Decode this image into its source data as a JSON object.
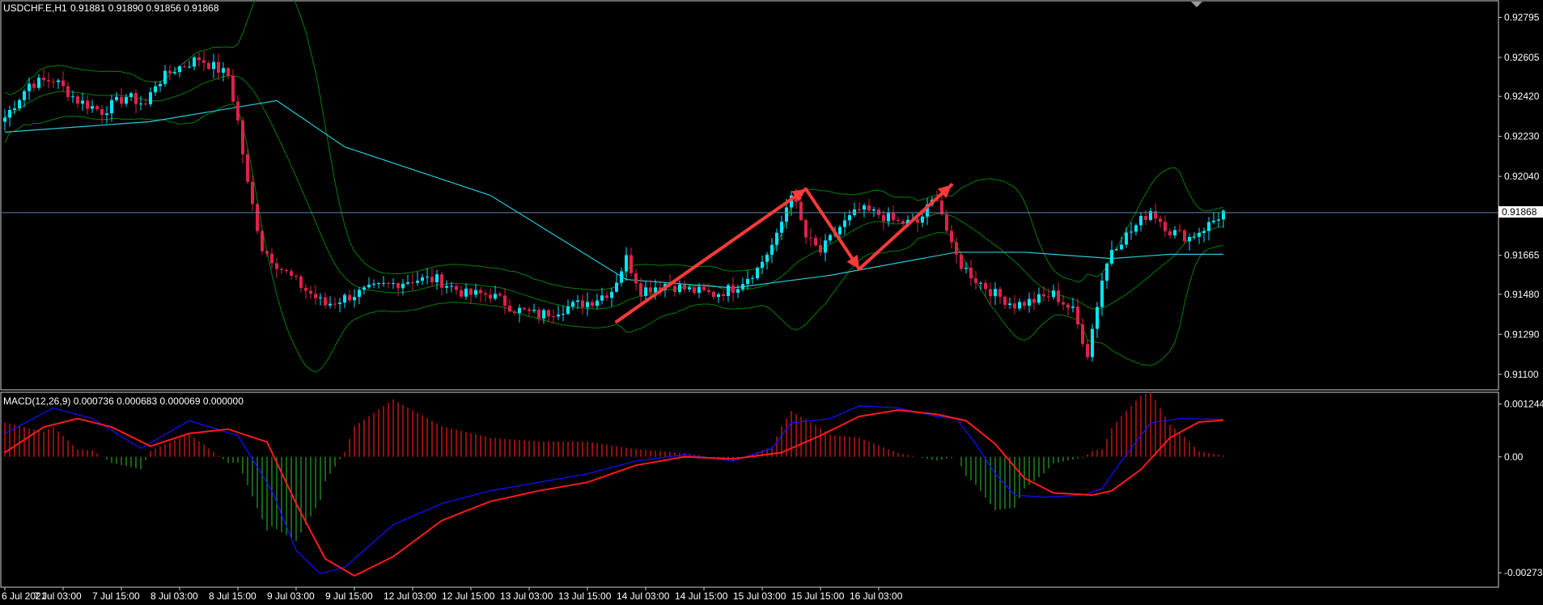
{
  "header": {
    "symbol_label": "USDCHF.E,H1",
    "ohlc_text": "0.91881 0.91890 0.91856 0.91868"
  },
  "macd_header": {
    "label": "MACD(12,26,9) 0.000736 0.000683 0.000069 0.000000"
  },
  "colors": {
    "background": "#000000",
    "frame": "#cfcfcf",
    "bull_candle": "#00e5ff",
    "bear_candle": "#e0204a",
    "bollinger": "#008000",
    "moving_average": "#28c8d8",
    "current_price_line": "#5a8aa8",
    "arrows": "#ff3b3b",
    "macd_line": "#1010ff",
    "signal_line": "#ff1a1a",
    "hist_positive": "#d01515",
    "hist_negative": "#1f8f1f"
  },
  "chart_data": [
    {
      "type": "candlestick",
      "title": "USDCHF.E,H1",
      "ylim": [
        0.9103,
        0.9287
      ],
      "y_ticks": [
        "0.92795",
        "0.92605",
        "0.92420",
        "0.92230",
        "0.92040",
        "0.91665",
        "0.91480",
        "0.91290",
        "0.91100"
      ],
      "current_price": "0.91868",
      "x_labels": [
        "6 Jul 2021",
        "7 Jul 03:00",
        "7 Jul 15:00",
        "8 Jul 03:00",
        "8 Jul 15:00",
        "9 Jul 03:00",
        "9 Jul 15:00",
        "12 Jul 03:00",
        "12 Jul 15:00",
        "13 Jul 03:00",
        "13 Jul 15:00",
        "14 Jul 03:00",
        "14 Jul 15:00",
        "15 Jul 03:00",
        "15 Jul 15:00",
        "16 Jul 03:00"
      ],
      "close_path": [
        [
          0,
          0.9232
        ],
        [
          5,
          0.9248
        ],
        [
          10,
          0.925
        ],
        [
          15,
          0.924
        ],
        [
          20,
          0.9235
        ],
        [
          25,
          0.9242
        ],
        [
          29,
          0.9238
        ],
        [
          31,
          0.9248
        ],
        [
          35,
          0.9255
        ],
        [
          40,
          0.926
        ],
        [
          46,
          0.9252
        ],
        [
          48,
          0.923
        ],
        [
          50,
          0.92
        ],
        [
          53,
          0.917
        ],
        [
          57,
          0.916
        ],
        [
          62,
          0.915
        ],
        [
          66,
          0.9143
        ],
        [
          72,
          0.9148
        ],
        [
          78,
          0.9152
        ],
        [
          84,
          0.9155
        ],
        [
          89,
          0.9155
        ],
        [
          95,
          0.9148
        ],
        [
          100,
          0.9148
        ],
        [
          105,
          0.9141
        ],
        [
          110,
          0.9138
        ],
        [
          116,
          0.9142
        ],
        [
          121,
          0.9145
        ],
        [
          125,
          0.915
        ],
        [
          128,
          0.9165
        ],
        [
          131,
          0.915
        ],
        [
          136,
          0.9153
        ],
        [
          141,
          0.915
        ],
        [
          146,
          0.9148
        ],
        [
          150,
          0.9151
        ],
        [
          155,
          0.916
        ],
        [
          159,
          0.9175
        ],
        [
          162,
          0.9197
        ],
        [
          165,
          0.9175
        ],
        [
          168,
          0.9168
        ],
        [
          172,
          0.918
        ],
        [
          176,
          0.9188
        ],
        [
          180,
          0.9186
        ],
        [
          184,
          0.9182
        ],
        [
          188,
          0.9182
        ],
        [
          192,
          0.9195
        ],
        [
          195,
          0.917
        ],
        [
          197,
          0.9162
        ],
        [
          200,
          0.9155
        ],
        [
          204,
          0.9148
        ],
        [
          208,
          0.9143
        ],
        [
          212,
          0.9145
        ],
        [
          216,
          0.9148
        ],
        [
          220,
          0.914
        ],
        [
          223,
          0.912
        ],
        [
          226,
          0.9155
        ],
        [
          228,
          0.917
        ],
        [
          232,
          0.9178
        ],
        [
          236,
          0.9188
        ],
        [
          240,
          0.9178
        ],
        [
          244,
          0.9175
        ],
        [
          248,
          0.9181
        ],
        [
          251,
          0.9187
        ]
      ],
      "series": [
        {
          "name": "Bollinger Bands",
          "x_end": 251
        },
        {
          "name": "Moving Average",
          "points": [
            [
              0,
              0.9225
            ],
            [
              30,
              0.923
            ],
            [
              56,
              0.924
            ],
            [
              70,
              0.9218
            ],
            [
              100,
              0.9195
            ],
            [
              128,
              0.9155
            ],
            [
              150,
              0.9151
            ],
            [
              170,
              0.9157
            ],
            [
              196,
              0.9168
            ],
            [
              210,
              0.9168
            ],
            [
              228,
              0.9165
            ],
            [
              240,
              0.9167
            ],
            [
              251,
              0.9167
            ]
          ]
        }
      ],
      "annotations": [
        {
          "type": "arrow",
          "from": [
            126,
            0.9135
          ],
          "to": [
            165,
            0.9198
          ]
        },
        {
          "type": "arrow",
          "from": [
            165,
            0.9198
          ],
          "to": [
            176,
            0.916
          ]
        },
        {
          "type": "arrow",
          "from": [
            176,
            0.916
          ],
          "to": [
            195,
            0.92
          ]
        }
      ]
    },
    {
      "type": "bar_line",
      "title": "MACD(12,26,9)",
      "ylim": [
        -0.00305,
        0.0015
      ],
      "y_ticks": [
        "0.001244",
        "0.00",
        "-0.002730"
      ],
      "series": [
        {
          "name": "MACD",
          "points": [
            [
              0,
              0.00055
            ],
            [
              10,
              0.00115
            ],
            [
              18,
              0.0009
            ],
            [
              28,
              0.0002
            ],
            [
              38,
              0.00085
            ],
            [
              48,
              0.0005
            ],
            [
              55,
              -0.0008
            ],
            [
              60,
              -0.0022
            ],
            [
              65,
              -0.00275
            ],
            [
              70,
              -0.0026
            ],
            [
              80,
              -0.0016
            ],
            [
              90,
              -0.0011
            ],
            [
              100,
              -0.0008
            ],
            [
              110,
              -0.0006
            ],
            [
              120,
              -0.0004
            ],
            [
              130,
              -0.0001
            ],
            [
              140,
              5e-05
            ],
            [
              150,
              -0.0001
            ],
            [
              158,
              0.0002
            ],
            [
              162,
              0.0008
            ],
            [
              170,
              0.0009
            ],
            [
              176,
              0.0012
            ],
            [
              184,
              0.00115
            ],
            [
              192,
              0.00095
            ],
            [
              196,
              0.0009
            ],
            [
              200,
              0.0003
            ],
            [
              204,
              -0.0004
            ],
            [
              208,
              -0.0009
            ],
            [
              214,
              -0.00095
            ],
            [
              222,
              -0.0009
            ],
            [
              226,
              -0.00075
            ],
            [
              230,
              -0.0001
            ],
            [
              236,
              0.0008
            ],
            [
              242,
              0.0009
            ],
            [
              251,
              0.00088
            ]
          ]
        },
        {
          "name": "Signal",
          "points": [
            [
              0,
              0.0001
            ],
            [
              8,
              0.0007
            ],
            [
              15,
              0.0009
            ],
            [
              22,
              0.0007
            ],
            [
              30,
              0.00025
            ],
            [
              38,
              0.00055
            ],
            [
              46,
              0.00065
            ],
            [
              54,
              0.00035
            ],
            [
              60,
              -0.0011
            ],
            [
              66,
              -0.0024
            ],
            [
              72,
              -0.0028
            ],
            [
              80,
              -0.00235
            ],
            [
              90,
              -0.0015
            ],
            [
              100,
              -0.00105
            ],
            [
              110,
              -0.0008
            ],
            [
              120,
              -0.0006
            ],
            [
              130,
              -0.0002
            ],
            [
              140,
              0.0
            ],
            [
              150,
              -5e-05
            ],
            [
              160,
              0.0001
            ],
            [
              168,
              0.0005
            ],
            [
              176,
              0.00095
            ],
            [
              184,
              0.0011
            ],
            [
              192,
              0.001
            ],
            [
              198,
              0.00085
            ],
            [
              204,
              0.0003
            ],
            [
              210,
              -0.0005
            ],
            [
              216,
              -0.00085
            ],
            [
              224,
              -0.0009
            ],
            [
              228,
              -0.0008
            ],
            [
              234,
              -0.0003
            ],
            [
              240,
              0.00045
            ],
            [
              246,
              0.00082
            ],
            [
              251,
              0.00086
            ]
          ]
        }
      ]
    }
  ]
}
